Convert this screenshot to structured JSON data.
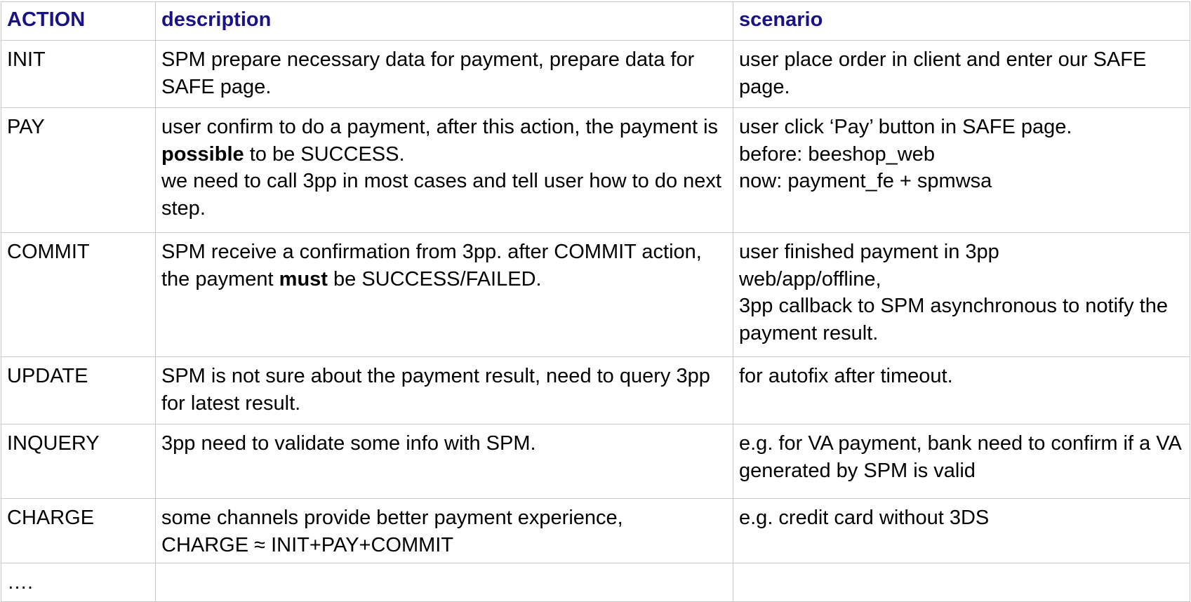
{
  "headers": {
    "action": "ACTION",
    "description": "description",
    "scenario": "scenario"
  },
  "rows": [
    {
      "action": "INIT",
      "description": [
        {
          "text": "SPM prepare necessary data for payment, prepare data for SAFE page."
        }
      ],
      "scenario": [
        "user place order in client and enter our SAFE page."
      ]
    },
    {
      "action": "PAY",
      "description": [
        {
          "before": "user confirm to do a payment, after this action, the payment is ",
          "bold": "possible",
          "after": " to be SUCCESS."
        },
        {
          "text": "we need to call 3pp in most cases and tell user how to do next step."
        }
      ],
      "scenario": [
        "user click ‘Pay’ button in SAFE page.",
        "before: beeshop_web",
        "now: payment_fe + spmwsa"
      ]
    },
    {
      "action": "COMMIT",
      "description": [
        {
          "before": "SPM receive a confirmation from 3pp. after COMMIT action, the payment ",
          "bold": "must",
          "after": " be SUCCESS/FAILED."
        }
      ],
      "scenario": [
        "user finished payment in 3pp web/app/offline,",
        "3pp callback to SPM asynchronous to notify the payment result."
      ]
    },
    {
      "action": "UPDATE",
      "description": [
        {
          "text": "SPM is not sure about the payment result, need to query 3pp for latest result."
        }
      ],
      "scenario": [
        "for autofix after timeout."
      ]
    },
    {
      "action": "INQUERY",
      "description": [
        {
          "text": "3pp need to validate some info with SPM."
        }
      ],
      "scenario": [
        "e.g. for VA payment, bank need to confirm if a VA generated by SPM is valid"
      ]
    },
    {
      "action": "CHARGE",
      "description": [
        {
          "text": "some channels provide better payment experience,"
        },
        {
          "text": "CHARGE ≈ INIT+PAY+COMMIT"
        }
      ],
      "scenario": [
        "e.g. credit card without 3DS"
      ]
    },
    {
      "action": "….",
      "description": [],
      "scenario": []
    }
  ],
  "colors": {
    "header_text": "#1a1385",
    "border": "#c8c8c8",
    "body_text": "#000000"
  }
}
